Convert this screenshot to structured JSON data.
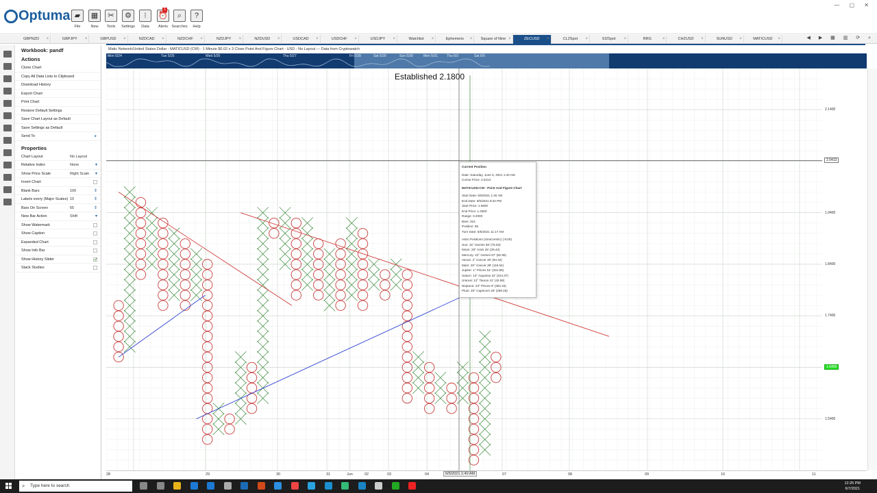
{
  "app": {
    "brand": "Optuma"
  },
  "toolbar": {
    "buttons": [
      {
        "label": "File",
        "icon": "folder-icon",
        "glyph": "▰"
      },
      {
        "label": "New",
        "icon": "new-icon",
        "glyph": "▦"
      },
      {
        "label": "Tools",
        "icon": "tools-icon",
        "glyph": "✂"
      },
      {
        "label": "Settings",
        "icon": "settings-icon",
        "glyph": "⚙"
      },
      {
        "label": "Data",
        "icon": "data-icon",
        "glyph": "⁝"
      },
      {
        "label": "Alerts",
        "icon": "alarm-icon",
        "glyph": "⏰",
        "badge": "1"
      },
      {
        "label": "Searches",
        "icon": "search-icon",
        "glyph": "⌕"
      },
      {
        "label": "Help",
        "icon": "help-icon",
        "glyph": "?"
      }
    ]
  },
  "tabs": [
    {
      "label": "GBPNZD"
    },
    {
      "label": "GBPJPY"
    },
    {
      "label": "GBPUSD"
    },
    {
      "label": "NZDCAD"
    },
    {
      "label": "NZDCHF"
    },
    {
      "label": "NZDJPY"
    },
    {
      "label": "NZDUSD"
    },
    {
      "label": "USDCAD"
    },
    {
      "label": "USDCHF"
    },
    {
      "label": "USDJPY"
    },
    {
      "label": "Watchlist"
    },
    {
      "label": "Ephemeris"
    },
    {
      "label": "Square of Nine"
    },
    {
      "label": "ZECUSD",
      "active": true
    },
    {
      "label": "CL2Spot"
    },
    {
      "label": "SI2Spot"
    },
    {
      "label": "RRG"
    },
    {
      "label": "CHZUSD"
    },
    {
      "label": "SUNUSD"
    },
    {
      "label": "MATICUSD"
    }
  ],
  "panel": {
    "workbook": "Workbook: pandf",
    "actions_title": "Actions",
    "actions": [
      "Clone Chart",
      "Copy All Data Lists to Clipboard",
      "Download History",
      "Export Chart",
      "Print Chart",
      "Restore Default Settings",
      "Save Chart Layout as Default",
      "Save Settings as Default",
      "Send To"
    ],
    "properties_title": "Properties",
    "properties": [
      {
        "name": "Chart Layout",
        "value": "No Layout",
        "ctrl": "none"
      },
      {
        "name": "Relative Index",
        "value": "None",
        "ctrl": "dropdown"
      },
      {
        "name": "Show Price Scale",
        "value": "Right Scale",
        "ctrl": "dropdown"
      },
      {
        "name": "Invert Chart",
        "value": "",
        "ctrl": "check",
        "checked": false
      },
      {
        "name": "Blank Bars",
        "value": "100",
        "ctrl": "spin"
      },
      {
        "name": "Labels every (Major Scales)",
        "value": "10",
        "ctrl": "spin"
      },
      {
        "name": "Bars On Screen",
        "value": "65",
        "ctrl": "spin"
      },
      {
        "name": "New Bar Action",
        "value": "Shift",
        "ctrl": "dropdown"
      },
      {
        "name": "Show Watermark",
        "value": "",
        "ctrl": "check",
        "checked": false
      },
      {
        "name": "Show Caption",
        "value": "",
        "ctrl": "check",
        "checked": false
      },
      {
        "name": "Expanded Chart",
        "value": "",
        "ctrl": "check",
        "checked": false
      },
      {
        "name": "Show Info Bar",
        "value": "",
        "ctrl": "check",
        "checked": false
      },
      {
        "name": "Show History Slider",
        "value": "",
        "ctrl": "check",
        "checked": true
      },
      {
        "name": "Stack Studies",
        "value": "",
        "ctrl": "check",
        "checked": false
      }
    ]
  },
  "chart": {
    "caption": "Matic Network/United States Dollar - MATICUSD (CW) - 1 Minute $0.02 x 3 Close Point And Figure Chart - USD - No Layout --- Data from Cryptowatch",
    "established": "Established 2.1800",
    "history_labels": [
      "Mon 5/24",
      "Tue 5/25",
      "Wed 5/26",
      "Thu 5/27",
      "Fri 5/28",
      "Sat 5/29",
      "Sun 5/30",
      "Mon 5/31",
      "Thu 6/3",
      "Sat 6/5"
    ],
    "price_labels": [
      "2.1400",
      "1.9400",
      "1.8400",
      "1.7400",
      "1.5400"
    ],
    "cursor_price": "2.0413",
    "last_price": "1.6400",
    "date_labels": [
      "28",
      "29",
      "30",
      "31",
      "Jun",
      "02",
      "03",
      "04",
      "07",
      "08",
      "09",
      "10",
      "11"
    ],
    "cursor_date": "6/5/2021 1:40 AM"
  },
  "chart_data": {
    "type": "point-and-figure",
    "symbol": "MATICUSD",
    "box_size": 0.02,
    "reversal": 3,
    "ylim": [
      1.44,
      2.22
    ],
    "columns": [
      {
        "dir": "O",
        "high": 1.76,
        "low": 1.66
      },
      {
        "dir": "X",
        "high": 1.98,
        "low": 1.68
      },
      {
        "dir": "O",
        "high": 1.96,
        "low": 1.82
      },
      {
        "dir": "X",
        "high": 1.94,
        "low": 1.84
      },
      {
        "dir": "O",
        "high": 1.92,
        "low": 1.76
      },
      {
        "dir": "X",
        "high": 1.9,
        "low": 1.78
      },
      {
        "dir": "O",
        "high": 1.88,
        "low": 1.76
      },
      {
        "dir": "X",
        "high": 1.86,
        "low": 1.78
      },
      {
        "dir": "O",
        "high": 1.84,
        "low": 1.5
      },
      {
        "dir": "X",
        "high": 1.56,
        "low": 1.52
      },
      {
        "dir": "O",
        "high": 1.54,
        "low": 1.52
      },
      {
        "dir": "X",
        "high": 1.66,
        "low": 1.54
      },
      {
        "dir": "O",
        "high": 1.64,
        "low": 1.56
      },
      {
        "dir": "X",
        "high": 1.94,
        "low": 1.58
      },
      {
        "dir": "O",
        "high": 1.92,
        "low": 1.9
      },
      {
        "dir": "X",
        "high": 1.94,
        "low": 1.84
      },
      {
        "dir": "O",
        "high": 1.92,
        "low": 1.78
      },
      {
        "dir": "X",
        "high": 1.92,
        "low": 1.8
      },
      {
        "dir": "O",
        "high": 1.88,
        "low": 1.78
      },
      {
        "dir": "X",
        "high": 1.86,
        "low": 1.76
      },
      {
        "dir": "O",
        "high": 1.88,
        "low": 1.76
      },
      {
        "dir": "X",
        "high": 1.92,
        "low": 1.78
      },
      {
        "dir": "O",
        "high": 1.9,
        "low": 1.76
      },
      {
        "dir": "X",
        "high": 1.84,
        "low": 1.8
      },
      {
        "dir": "O",
        "high": 1.82,
        "low": 1.78
      },
      {
        "dir": "X",
        "high": 1.84,
        "low": 1.8
      },
      {
        "dir": "O",
        "high": 1.82,
        "low": 1.58
      },
      {
        "dir": "X",
        "high": 1.66,
        "low": 1.6
      },
      {
        "dir": "O",
        "high": 1.64,
        "low": 1.56
      },
      {
        "dir": "X",
        "high": 1.62,
        "low": 1.58
      },
      {
        "dir": "O",
        "high": 1.6,
        "low": 1.56
      },
      {
        "dir": "X",
        "high": 1.64,
        "low": 1.58
      },
      {
        "dir": "O",
        "high": 1.62,
        "low": 1.46
      },
      {
        "dir": "X",
        "high": 1.7,
        "low": 1.48
      },
      {
        "dir": "O",
        "high": 1.66,
        "low": 1.62
      }
    ],
    "trendlines": [
      {
        "name": "resistance-1",
        "color": "#d23c3c",
        "from": [
          0,
          1.98
        ],
        "to": [
          6,
          1.76
        ]
      },
      {
        "name": "resistance-2",
        "color": "#d23c3c",
        "from": [
          11,
          1.94
        ],
        "to": [
          17,
          1.7
        ]
      },
      {
        "name": "support-1",
        "color": "#2b3fd1",
        "from": [
          0,
          1.66
        ],
        "to": [
          3,
          1.78
        ]
      },
      {
        "name": "support-2",
        "color": "#2b3fd1",
        "from": [
          7,
          1.54
        ],
        "to": [
          12,
          1.78
        ]
      }
    ]
  },
  "tooltip": {
    "lines": [
      {
        "t": "Current Position",
        "b": true
      },
      {
        "t": ""
      },
      {
        "t": "Date: Saturday, June 5, 2021 1:40 AM"
      },
      {
        "t": "Cursor Price: 2.0413"
      },
      {
        "t": ""
      },
      {
        "t": "MATICUSD:CW - Point And Figure Chart",
        "b": true
      },
      {
        "t": ""
      },
      {
        "t": "Start Date: 6/5/2021 1:40 AM"
      },
      {
        "t": "End Date: 6/5/2021 9:34 PM"
      },
      {
        "t": "Start Price: 1.6600"
      },
      {
        "t": "End Price: 1.4600"
      },
      {
        "t": "Range: 0.2000"
      },
      {
        "t": "Bars: 315"
      },
      {
        "t": "Position: 95"
      },
      {
        "t": "Turn Date: 6/5/2021 11:17 AM"
      },
      {
        "t": ""
      },
      {
        "t": "Astro Positions (GeoCentric) (-5:00)"
      },
      {
        "t": "Sun: 15° Gemini 38' (75.63)"
      },
      {
        "t": "Moon: 28° Aries 25' (28.42)"
      },
      {
        "t": "Mercury: 22° Gemini 57' (82.95)"
      },
      {
        "t": "Venus: 4° Cancer 20' (94.34)"
      },
      {
        "t": "Mars: 26° Cancer 38' (116.64)"
      },
      {
        "t": "Jupiter: 1° Pisces 51' (331.85)"
      },
      {
        "t": "Saturn: 13° Aquarius 22' (313.37)"
      },
      {
        "t": "Uranus: 12° Taurus 41' (42.69)"
      },
      {
        "t": "Neptune: 23° Pisces 9' (353.15)"
      },
      {
        "t": "Pluto: 26° Capricorn 28' (296.46)"
      }
    ]
  },
  "taskbar": {
    "search_placeholder": "Type here to search",
    "time": "12:25 PM",
    "date": "6/7/2021"
  }
}
